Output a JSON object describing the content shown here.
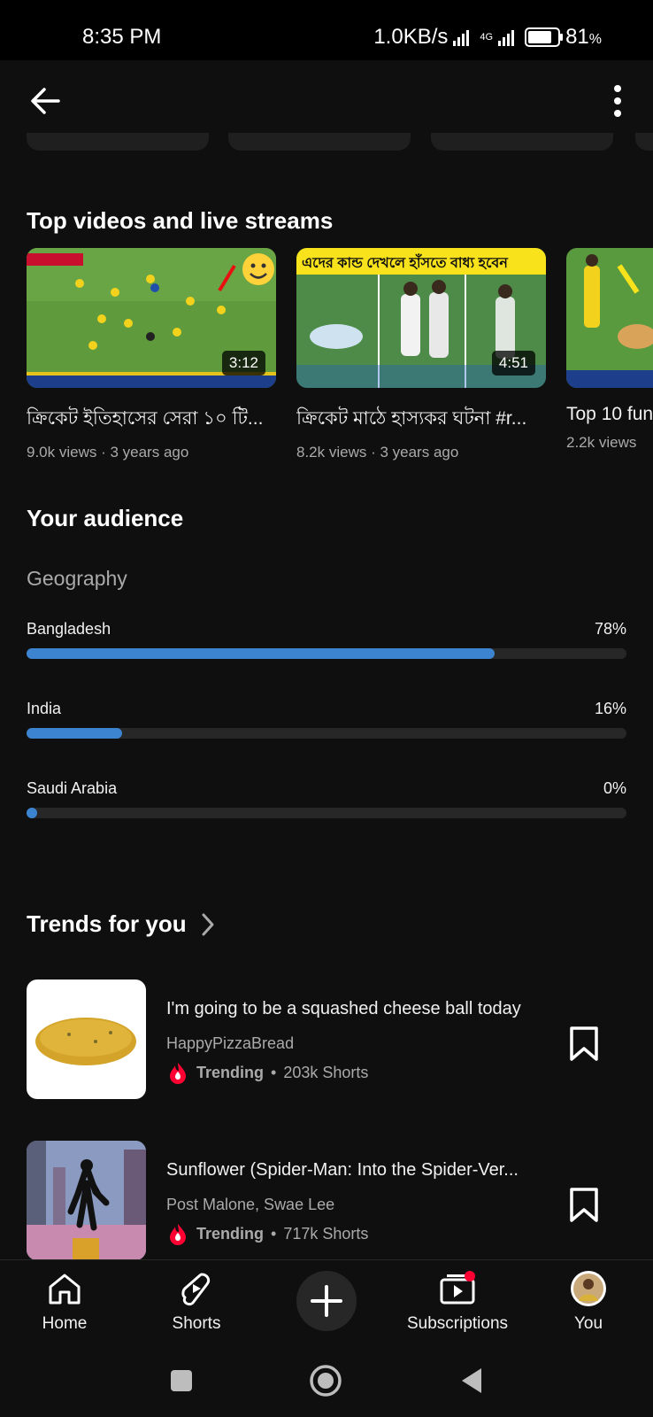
{
  "status_bar": {
    "time": "8:35 PM",
    "speed": "1.0KB/s",
    "network": "4G",
    "battery": "81",
    "battery_unit": "%"
  },
  "top_videos": {
    "heading": "Top videos and live streams",
    "items": [
      {
        "title": "ক্রিকেট ইতিহাসের সেরা ১০ টি...",
        "meta": "9.0k views · 3 years ago",
        "duration": "3:12"
      },
      {
        "title": "ক্রিকেট মাঠে হাস্যকর ঘটনা #r...",
        "meta": "8.2k views · 3 years ago",
        "duration": "4:51",
        "banner": "এদের কান্ড দেখলে হাঁসতে বাধ্য হবেন"
      },
      {
        "title": "Top 10 fun",
        "meta": "2.2k views",
        "duration": ""
      }
    ]
  },
  "audience": {
    "heading": "Your audience",
    "geography_label": "Geography",
    "countries": [
      {
        "name": "Bangladesh",
        "percent_label": "78%",
        "fraction": 0.78
      },
      {
        "name": "India",
        "percent_label": "16%",
        "fraction": 0.16
      },
      {
        "name": "Saudi Arabia",
        "percent_label": "0%",
        "fraction": 0.0
      }
    ]
  },
  "trends": {
    "heading": "Trends for you",
    "items": [
      {
        "title": "I'm going to be a squashed cheese ball today",
        "artist": "HappyPizzaBread",
        "trend_label": "Trending",
        "dot": "•",
        "shorts": "203k Shorts"
      },
      {
        "title": "Sunflower (Spider-Man: Into the Spider-Ver...",
        "artist": "Post Malone, Swae Lee",
        "trend_label": "Trending",
        "dot": "•",
        "shorts": "717k Shorts"
      }
    ]
  },
  "nav": {
    "home": "Home",
    "shorts": "Shorts",
    "subscriptions": "Subscriptions",
    "you": "You"
  },
  "colors": {
    "background": "#0f0f0f",
    "bar_fill": "#3c84d0",
    "bar_track": "#272727",
    "trending_red": "#ff0033"
  }
}
